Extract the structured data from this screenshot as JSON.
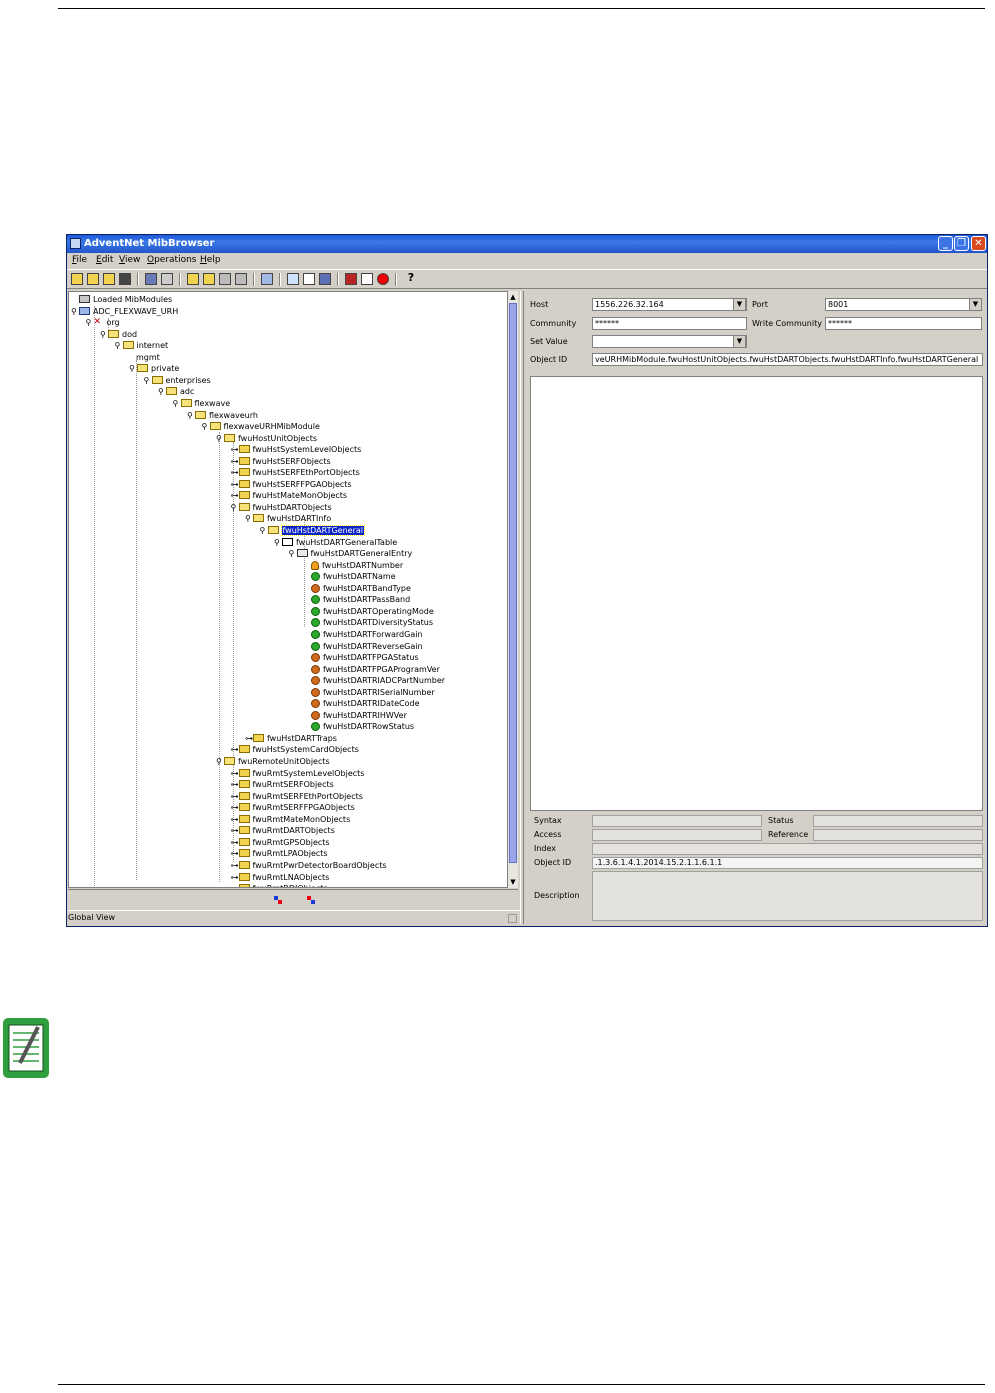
{
  "window": {
    "title": "AdventNet MibBrowser",
    "menu": [
      "File",
      "Edit",
      "View",
      "Operations",
      "Help"
    ],
    "toolbar_icons": [
      "open-icon",
      "load-icon",
      "unload-icon",
      "find-icon",
      "save-icon",
      "print-icon",
      "copy-icon",
      "paste-icon",
      "delete-icon",
      "settings-icon",
      "trap-icon",
      "graph-icon",
      "table-icon",
      "debug-icon",
      "edit-icon",
      "stop-icon",
      "help-icon"
    ],
    "help_glyph": "?"
  },
  "tree": [
    {
      "label": "Loaded MibModules",
      "level": 0,
      "icon": "root",
      "handle": ""
    },
    {
      "label": "ADC_FLEXWAVE_URH",
      "level": 0,
      "icon": "mod",
      "handle": "⚲"
    },
    {
      "label": "org",
      "level": 1,
      "icon": "org",
      "handle": "⚲"
    },
    {
      "label": "dod",
      "level": 2,
      "icon": "folder-open",
      "handle": "⚲"
    },
    {
      "label": "internet",
      "level": 3,
      "icon": "folder-open",
      "handle": "⚲"
    },
    {
      "label": "mgmt",
      "level": 4,
      "icon": "none",
      "handle": ""
    },
    {
      "label": "private",
      "level": 4,
      "icon": "folder-open",
      "handle": "⚲"
    },
    {
      "label": "enterprises",
      "level": 5,
      "icon": "folder-open",
      "handle": "⚲"
    },
    {
      "label": "adc",
      "level": 6,
      "icon": "folder-open",
      "handle": "⚲"
    },
    {
      "label": "flexwave",
      "level": 7,
      "icon": "folder-open",
      "handle": "⚲"
    },
    {
      "label": "flexwaveurh",
      "level": 8,
      "icon": "folder-open",
      "handle": "⚲"
    },
    {
      "label": "flexwaveURHMibModule",
      "level": 9,
      "icon": "folder-open",
      "handle": "⚲"
    },
    {
      "label": "fwuHostUnitObjects",
      "level": 10,
      "icon": "folder-open",
      "handle": "⚲"
    },
    {
      "label": "fwuHstSystemLevelObjects",
      "level": 11,
      "icon": "folder",
      "handle": "⊶"
    },
    {
      "label": "fwuHstSERFObjects",
      "level": 11,
      "icon": "folder",
      "handle": "⊶"
    },
    {
      "label": "fwuHstSERFEthPortObjects",
      "level": 11,
      "icon": "folder",
      "handle": "⊶"
    },
    {
      "label": "fwuHstSERFFPGAObjects",
      "level": 11,
      "icon": "folder",
      "handle": "⊶"
    },
    {
      "label": "fwuHstMateMonObjects",
      "level": 11,
      "icon": "folder",
      "handle": "⊶"
    },
    {
      "label": "fwuHstDARTObjects",
      "level": 11,
      "icon": "folder-open",
      "handle": "⚲"
    },
    {
      "label": "fwuHstDARTInfo",
      "level": 12,
      "icon": "folder-open",
      "handle": "⚲"
    },
    {
      "label": "fwuHstDARTGeneral",
      "level": 13,
      "icon": "folder-open",
      "handle": "⚲",
      "selected": true
    },
    {
      "label": "fwuHstDARTGeneralTable",
      "level": 14,
      "icon": "table",
      "handle": "⚲"
    },
    {
      "label": "fwuHstDARTGeneralEntry",
      "level": 15,
      "icon": "entry",
      "handle": "⚲"
    },
    {
      "label": "fwuHstDARTNumber",
      "level": 16,
      "icon": "key",
      "handle": ""
    },
    {
      "label": "fwuHstDARTName",
      "level": 16,
      "icon": "leaf",
      "handle": ""
    },
    {
      "label": "fwuHstDARTBandType",
      "level": 16,
      "icon": "leaf-ro",
      "handle": ""
    },
    {
      "label": "fwuHstDARTPassBand",
      "level": 16,
      "icon": "leaf",
      "handle": ""
    },
    {
      "label": "fwuHstDARTOperatingMode",
      "level": 16,
      "icon": "leaf",
      "handle": ""
    },
    {
      "label": "fwuHstDARTDiversityStatus",
      "level": 16,
      "icon": "leaf",
      "handle": ""
    },
    {
      "label": "fwuHstDARTForwardGain",
      "level": 16,
      "icon": "leaf",
      "handle": ""
    },
    {
      "label": "fwuHstDARTReverseGain",
      "level": 16,
      "icon": "leaf",
      "handle": ""
    },
    {
      "label": "fwuHstDARTFPGAStatus",
      "level": 16,
      "icon": "leaf-ro",
      "handle": ""
    },
    {
      "label": "fwuHstDARTFPGAProgramVer",
      "level": 16,
      "icon": "leaf-ro",
      "handle": ""
    },
    {
      "label": "fwuHstDARTRIADCPartNumber",
      "level": 16,
      "icon": "leaf-ro",
      "handle": ""
    },
    {
      "label": "fwuHstDARTRISerialNumber",
      "level": 16,
      "icon": "leaf-ro",
      "handle": ""
    },
    {
      "label": "fwuHstDARTRIDateCode",
      "level": 16,
      "icon": "leaf-ro",
      "handle": ""
    },
    {
      "label": "fwuHstDARTRIHWVer",
      "level": 16,
      "icon": "leaf-ro",
      "handle": ""
    },
    {
      "label": "fwuHstDARTRowStatus",
      "level": 16,
      "icon": "leaf",
      "handle": ""
    },
    {
      "label": "fwuHstDARTTraps",
      "level": 12,
      "icon": "folder",
      "handle": "⊶"
    },
    {
      "label": "fwuHstSystemCardObjects",
      "level": 11,
      "icon": "folder",
      "handle": "⊶"
    },
    {
      "label": "fwuRemoteUnitObjects",
      "level": 10,
      "icon": "folder-open",
      "handle": "⚲"
    },
    {
      "label": "fwuRmtSystemLevelObjects",
      "level": 11,
      "icon": "folder",
      "handle": "⊶"
    },
    {
      "label": "fwuRmtSERFObjects",
      "level": 11,
      "icon": "folder",
      "handle": "⊶"
    },
    {
      "label": "fwuRmtSERFEthPortObjects",
      "level": 11,
      "icon": "folder",
      "handle": "⊶"
    },
    {
      "label": "fwuRmtSERFFPGAObjects",
      "level": 11,
      "icon": "folder",
      "handle": "⊶"
    },
    {
      "label": "fwuRmtMateMonObjects",
      "level": 11,
      "icon": "folder",
      "handle": "⊶"
    },
    {
      "label": "fwuRmtDARTObjects",
      "level": 11,
      "icon": "folder",
      "handle": "⊶"
    },
    {
      "label": "fwuRmtGPSObjects",
      "level": 11,
      "icon": "folder",
      "handle": "⊶"
    },
    {
      "label": "fwuRmtLPAObjects",
      "level": 11,
      "icon": "folder",
      "handle": "⊶"
    },
    {
      "label": "fwuRmtPwrDetectorBoardObjects",
      "level": 11,
      "icon": "folder",
      "handle": "⊶"
    },
    {
      "label": "fwuRmtLNAObjects",
      "level": 11,
      "icon": "folder",
      "handle": "⊶"
    },
    {
      "label": "fwuRmtRDIObjects",
      "level": 11,
      "icon": "folder",
      "handle": "⊶"
    }
  ],
  "status_bar": "Global View",
  "form": {
    "host_label": "Host",
    "host_value": "1556.226.32.164",
    "port_label": "Port",
    "port_value": "8001",
    "community_label": "Community",
    "community_value": "******",
    "write_community_label": "Write Community",
    "write_community_value": "******",
    "set_value_label": "Set Value",
    "set_value_value": "",
    "object_id_label": "Object ID",
    "object_id_value": "veURHMibModule.fwuHostUnitObjects.fwuHstDARTObjects.fwuHstDARTInfo.fwuHstDARTGeneral"
  },
  "details": {
    "syntax_label": "Syntax",
    "syntax_value": "",
    "status_label": "Status",
    "status_value": "",
    "access_label": "Access",
    "access_value": "",
    "reference_label": "Reference",
    "reference_value": "",
    "index_label": "Index",
    "index_value": "",
    "object_id_label": "Object ID",
    "object_id_value": ".1.3.6.1.4.1.2014.15.2.1.1.6.1.1",
    "description_label": "Description",
    "description_value": ""
  },
  "colors": {
    "selection": "#0a24c8",
    "titlebar": "#2155c9",
    "scroll_thumb": "#9aa6e8"
  }
}
